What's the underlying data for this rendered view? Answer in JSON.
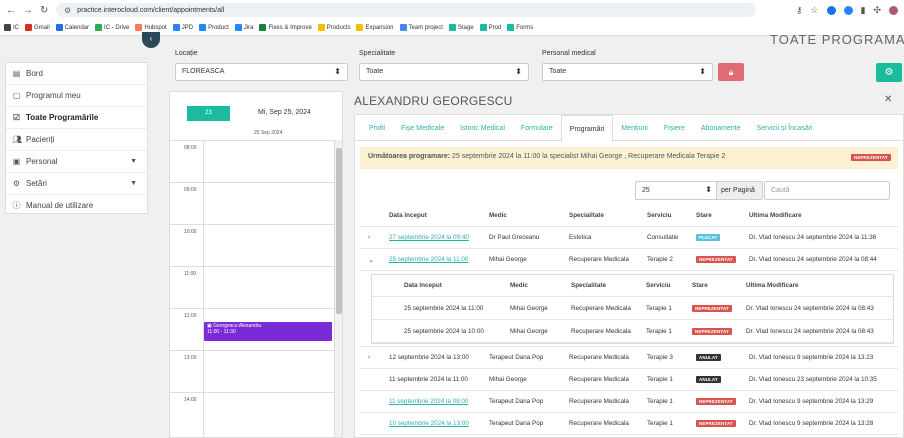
{
  "browser": {
    "url": "practice.interocloud.com/client/appointments/all",
    "bookmarks": [
      {
        "label": "IC",
        "color": "#444444"
      },
      {
        "label": "Gmail",
        "color": "#d93025"
      },
      {
        "label": "Calendar",
        "color": "#1a73e8"
      },
      {
        "label": "IC - Drive",
        "color": "#34a853"
      },
      {
        "label": "Hubspot",
        "color": "#ff7a59"
      },
      {
        "label": "JPD",
        "color": "#2684ff"
      },
      {
        "label": "Product",
        "color": "#2684ff"
      },
      {
        "label": "Jira",
        "color": "#2684ff"
      },
      {
        "label": "Fixes & Improve",
        "color": "#188038"
      },
      {
        "label": "Products",
        "color": "#fbbc04"
      },
      {
        "label": "Expansion",
        "color": "#fbbc04"
      },
      {
        "label": "Team project",
        "color": "#4285f4"
      },
      {
        "label": "Stage",
        "color": "#1abc9c"
      },
      {
        "label": "Prod",
        "color": "#1abc9c"
      },
      {
        "label": "Forms",
        "color": "#1abc9c"
      }
    ]
  },
  "page": {
    "title": "TOATE PROGRAMARILE"
  },
  "filters": {
    "location_label": "Locație",
    "location_value": "FLOREASCA",
    "specialty_label": "Specialitate",
    "specialty_value": "Toate",
    "staff_label": "Personal medical",
    "staff_value": "Toate"
  },
  "sidebar": {
    "items": [
      {
        "label": "Bord",
        "icon": "dashboard-icon"
      },
      {
        "label": "Programul meu",
        "icon": "calendar-icon"
      },
      {
        "label": "Toate Programările",
        "icon": "calendar-check-icon"
      },
      {
        "label": "Pacienți",
        "icon": "users-icon"
      },
      {
        "label": "Personal",
        "icon": "id-card-icon"
      },
      {
        "label": "Setări",
        "icon": "gear-icon"
      },
      {
        "label": "Manual de utilizare",
        "icon": "help-icon"
      }
    ]
  },
  "calendar": {
    "date_button": "23",
    "title": "Mi, Sep 25, 2024",
    "subtitle": "25 Sep 2024",
    "hours": [
      "08:00",
      "09:00",
      "10:00",
      "11:00",
      "12:00",
      "13:00",
      "14:00"
    ],
    "event": {
      "title": "Georgescu Alexandru",
      "time": "11:00 - 11:30",
      "color": "#7b2ad8"
    }
  },
  "patient": {
    "name": "ALEXANDRU GEORGESCU"
  },
  "tabs": [
    "Profil",
    "Fișe Medicale",
    "Istoric Medical",
    "Formulare",
    "Programări",
    "Mențiuni",
    "Fișiere",
    "Abonamente",
    "Servicii și Încasări"
  ],
  "alert": {
    "label": "Următoarea programare:",
    "text": "25 septembrie 2024 la 11:00 la specialist Mihai George , Recuperare Medicala Terapie 2",
    "badge": "NEPREZENTAT"
  },
  "pagination": {
    "per_page": "25",
    "per_page_label": "per Pagină",
    "search_placeholder": "Caută"
  },
  "table": {
    "headers": [
      "Data început",
      "Medic",
      "Specialitate",
      "Serviciu",
      "Stare",
      "Ultima Modificare"
    ],
    "rows": [
      {
        "date": "27 septembrie 2024 la 09:40",
        "medic": "Dr Paul Greceanu",
        "specialitate": "Estetica",
        "serviciu": "Consultatie",
        "stare": "PLECAT",
        "modificare": "Dr. Vlad Ionescu 24 septembrie 2024 la 11:36",
        "link": true,
        "expander": "›"
      },
      {
        "date": "25 septembrie 2024 la 11:00",
        "medic": "Mihai George",
        "specialitate": "Recuperare Medicala",
        "serviciu": "Terapie 2",
        "stare": "NEPREZENTAT",
        "modificare": "Dr. Vlad Ionescu 24 septembrie 2024 la 08:44",
        "link": true,
        "expander": "⌄"
      }
    ],
    "sub": {
      "headers": [
        "Data început",
        "Medic",
        "Specialitate",
        "Serviciu",
        "Stare",
        "Ultima Modificare"
      ],
      "rows": [
        {
          "date": "25 septembrie 2024 la 11:00",
          "medic": "Mihai George",
          "specialitate": "Recuperare Medicala",
          "serviciu": "Terapie 1",
          "stare": "NEPREZENTAT",
          "modificare": "Dr. Vlad Ionescu 24 septembrie 2024 la 08:43"
        },
        {
          "date": "25 septembrie 2024 la 10:00",
          "medic": "Mihai George",
          "specialitate": "Recuperare Medicala",
          "serviciu": "Terapie 1",
          "stare": "NEPREZENTAT",
          "modificare": "Dr. Vlad Ionescu 24 septembrie 2024 la 08:43"
        }
      ]
    },
    "rows_after": [
      {
        "date": "12 septembrie 2024 la 13:00",
        "medic": "Terapeut Dana Pop",
        "specialitate": "Recuperare Medicala",
        "serviciu": "Terapie 3",
        "stare": "ANULAT",
        "modificare": "Dr. Vlad Ionescu 9 septembrie 2024 la 13:23",
        "link": false,
        "expander": "›"
      },
      {
        "date": "11 septembrie 2024 la 11:00",
        "medic": "Mihai George",
        "specialitate": "Recuperare Medicala",
        "serviciu": "Terapie 1",
        "stare": "ANULAT",
        "modificare": "Dr. Vlad Ionescu 23 septembrie 2024 la 10:35",
        "link": false,
        "expander": ""
      },
      {
        "date": "11 septembrie 2024 la 09:00",
        "medic": "Terapeut Dana Pop",
        "specialitate": "Recuperare Medicala",
        "serviciu": "Terapie 1",
        "stare": "NEPREZENTAT",
        "modificare": "Dr. Vlad Ionescu 9 septembrie 2024 la 13:29",
        "link": true,
        "expander": ""
      },
      {
        "date": "10 septembrie 2024 la 13:00",
        "medic": "Terapeut Dana Pop",
        "specialitate": "Recuperare Medicala",
        "serviciu": "Terapie 1",
        "stare": "NEPREZENTAT",
        "modificare": "Dr. Vlad Ionescu 9 septembrie 2024 la 13:28",
        "link": true,
        "expander": ""
      }
    ]
  },
  "colors": {
    "accent": "#1abc9c",
    "danger": "#d9534f",
    "info": "#5bc0de",
    "dark": "#333333",
    "event": "#7b2ad8",
    "alert_bg": "#fcf1d3"
  }
}
